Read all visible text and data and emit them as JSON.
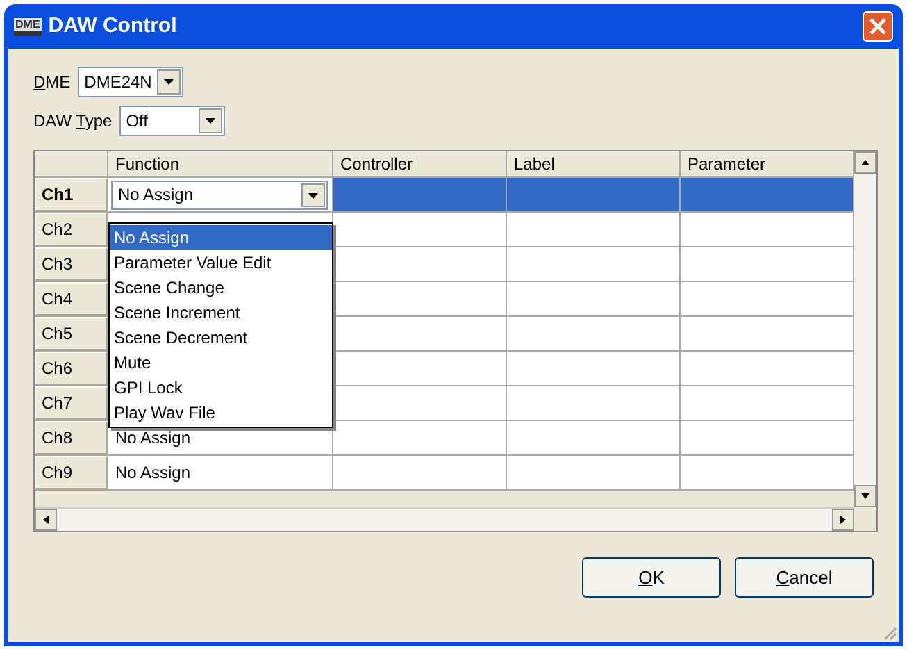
{
  "window": {
    "title": "DAW Control",
    "icon": "DME"
  },
  "fields": [
    {
      "key": "D",
      "post": "ME",
      "value": "DME24N"
    },
    {
      "pre": "DAW ",
      "key": "T",
      "post": "ype",
      "value": "Off"
    }
  ],
  "grid": {
    "columns": [
      "Function",
      "Controller",
      "Label",
      "Parameter"
    ],
    "rows": [
      {
        "header": "Ch1",
        "function": "No Assign",
        "selected": true
      },
      {
        "header": "Ch2",
        "selected": false
      },
      {
        "header": "Ch3",
        "selected": false
      },
      {
        "header": "Ch4",
        "selected": false
      },
      {
        "header": "Ch5",
        "selected": false
      },
      {
        "header": "Ch6",
        "selected": false
      },
      {
        "header": "Ch7",
        "selected": false
      },
      {
        "header": "Ch8",
        "function": "No Assign",
        "selected": false
      },
      {
        "header": "Ch9",
        "function": "No Assign",
        "selected": false
      }
    ]
  },
  "dropdown": {
    "options": [
      {
        "label": "No Assign",
        "selected": true
      },
      {
        "label": "Parameter Value Edit",
        "selected": false
      },
      {
        "label": "Scene Change",
        "selected": false
      },
      {
        "label": "Scene Increment",
        "selected": false
      },
      {
        "label": "Scene Decrement",
        "selected": false
      },
      {
        "label": "Mute",
        "selected": false
      },
      {
        "label": "GPI Lock",
        "selected": false
      },
      {
        "label": "Play Wav File",
        "selected": false
      }
    ]
  },
  "buttons": [
    {
      "key": "O",
      "post": "K"
    },
    {
      "key": "C",
      "post": "ancel"
    }
  ]
}
